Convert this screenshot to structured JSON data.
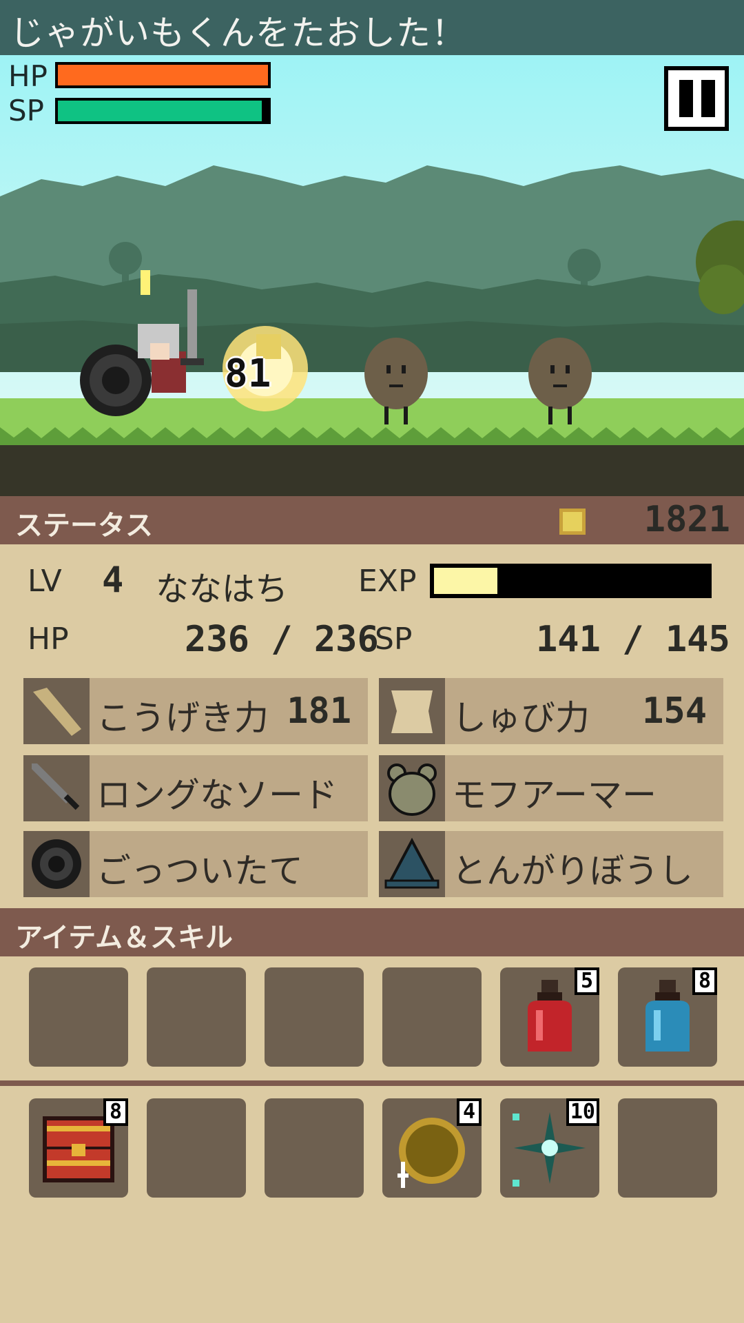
{
  "message": "じゃがいもくんをたおした！",
  "hud": {
    "hp_label": "HP",
    "sp_label": "SP",
    "hp_fill": 1.0,
    "sp_fill": 0.97
  },
  "battle": {
    "damage": "81"
  },
  "status": {
    "title": "ステータス",
    "gold": "1821",
    "lv_label": "LV",
    "lv_value": "4",
    "player_name": "ななはち",
    "exp_label": "EXP",
    "exp_fill": 0.23,
    "hp_label": "HP",
    "hp_value": "236 / 236",
    "sp_label": "SP",
    "sp_value": "141 / 145",
    "attack_label": "こうげき力",
    "attack_value": "181",
    "defense_label": "しゅび力",
    "defense_value": "154",
    "weapon": "ロングなソード",
    "armor": "モフアーマー",
    "shield": "ごっついたて",
    "helmet": "とんがりぼうし"
  },
  "items": {
    "title": "アイテム＆スキル",
    "row1": [
      {
        "icon": "",
        "count": ""
      },
      {
        "icon": "",
        "count": ""
      },
      {
        "icon": "",
        "count": ""
      },
      {
        "icon": "",
        "count": ""
      },
      {
        "icon": "red-potion-icon",
        "count": "5"
      },
      {
        "icon": "blue-potion-icon",
        "count": "8"
      }
    ],
    "row2": [
      {
        "icon": "treasure-chest-icon",
        "count": "8"
      },
      {
        "icon": "",
        "count": ""
      },
      {
        "icon": "",
        "count": ""
      },
      {
        "icon": "gold-ring-icon",
        "count": "4"
      },
      {
        "icon": "sparkle-skill-icon",
        "count": "10"
      },
      {
        "icon": "",
        "count": ""
      }
    ]
  },
  "colors": {
    "hp_bar": "#ff6a1e",
    "sp_bar": "#0fc283",
    "exp_bar": "#fcf6a7",
    "header": "#7e5a4e",
    "panel": "#dccba3"
  }
}
